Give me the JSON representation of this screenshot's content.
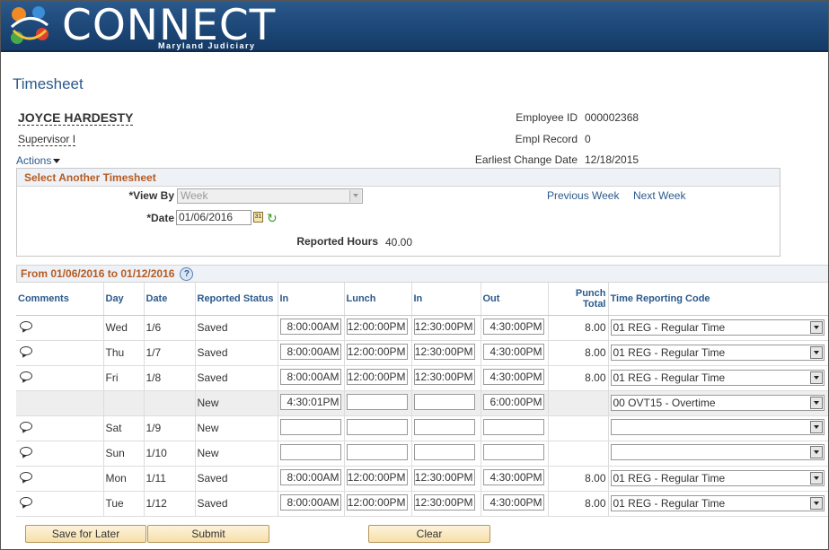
{
  "brand": {
    "name": "CONNECT",
    "subtitle": "Maryland Judiciary"
  },
  "page_title": "Timesheet",
  "employee": {
    "name": "JOYCE HARDESTY",
    "title": "Supervisor I",
    "actions_label": "Actions",
    "employee_id_label": "Employee ID",
    "employee_id": "000002368",
    "empl_record_label": "Empl Record",
    "empl_record": "0",
    "earliest_change_label": "Earliest Change Date",
    "earliest_change": "12/18/2015"
  },
  "select_timesheet": {
    "heading": "Select Another Timesheet",
    "view_by_label": "*View By",
    "view_by_value": "Week",
    "date_label": "*Date",
    "date_value": "01/06/2016",
    "previous_week": "Previous Week",
    "next_week": "Next Week",
    "reported_hours_label": "Reported Hours",
    "reported_hours": "40.00"
  },
  "period": {
    "heading": "From 01/06/2016 to 01/12/2016",
    "columns": [
      "Comments",
      "Day",
      "Date",
      "Reported Status",
      "In",
      "Lunch",
      "In",
      "Out",
      "Punch Total",
      "Time Reporting Code"
    ],
    "rows": [
      {
        "comment": true,
        "day": "Wed",
        "date": "1/6",
        "status": "Saved",
        "in1": "8:00:00AM",
        "lunch": "12:00:00PM",
        "in2": "12:30:00PM",
        "out": "4:30:00PM",
        "total": "8.00",
        "trc": "01 REG - Regular Time"
      },
      {
        "comment": true,
        "day": "Thu",
        "date": "1/7",
        "status": "Saved",
        "in1": "8:00:00AM",
        "lunch": "12:00:00PM",
        "in2": "12:30:00PM",
        "out": "4:30:00PM",
        "total": "8.00",
        "trc": "01 REG - Regular Time"
      },
      {
        "comment": true,
        "day": "Fri",
        "date": "1/8",
        "status": "Saved",
        "in1": "8:00:00AM",
        "lunch": "12:00:00PM",
        "in2": "12:30:00PM",
        "out": "4:30:00PM",
        "total": "8.00",
        "trc": "01 REG - Regular Time"
      },
      {
        "comment": false,
        "day": "",
        "date": "",
        "status": "New",
        "in1": "4:30:01PM",
        "lunch": "",
        "in2": "",
        "out": "6:00:00PM",
        "total": "",
        "trc": "00 OVT15 - Overtime"
      },
      {
        "comment": true,
        "day": "Sat",
        "date": "1/9",
        "status": "New",
        "in1": "",
        "lunch": "",
        "in2": "",
        "out": "",
        "total": "",
        "trc": ""
      },
      {
        "comment": true,
        "day": "Sun",
        "date": "1/10",
        "status": "New",
        "in1": "",
        "lunch": "",
        "in2": "",
        "out": "",
        "total": "",
        "trc": ""
      },
      {
        "comment": true,
        "day": "Mon",
        "date": "1/11",
        "status": "Saved",
        "in1": "8:00:00AM",
        "lunch": "12:00:00PM",
        "in2": "12:30:00PM",
        "out": "4:30:00PM",
        "total": "8.00",
        "trc": "01 REG - Regular Time"
      },
      {
        "comment": true,
        "day": "Tue",
        "date": "1/12",
        "status": "Saved",
        "in1": "8:00:00AM",
        "lunch": "12:00:00PM",
        "in2": "12:30:00PM",
        "out": "4:30:00PM",
        "total": "8.00",
        "trc": "01 REG - Regular Time"
      }
    ]
  },
  "buttons": {
    "save_for_later": "Save for Later",
    "submit": "Submit",
    "clear": "Clear"
  },
  "colors": {
    "banner": "#1f4a7a",
    "section_heading": "#b55b23",
    "link": "#2b5a8c",
    "button": "#f6dfa9"
  }
}
